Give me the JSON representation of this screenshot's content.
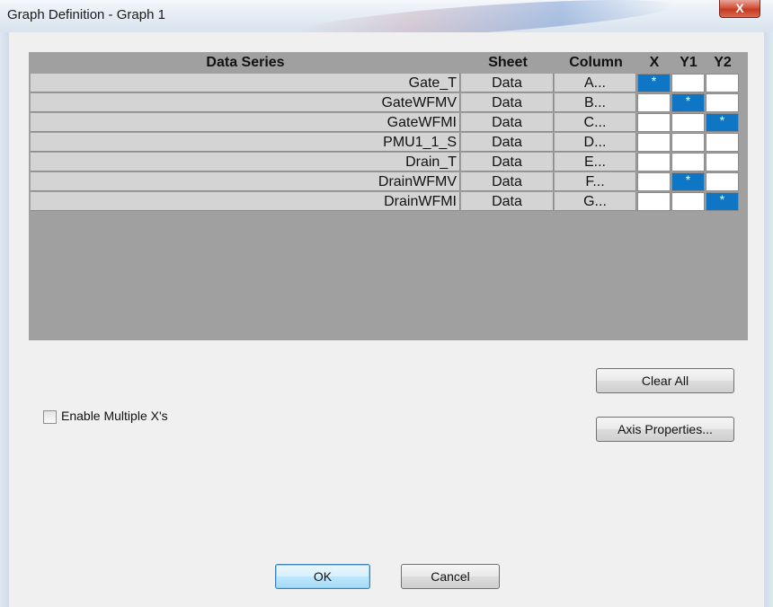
{
  "window": {
    "title": "Graph Definition - Graph 1",
    "close_label": "X"
  },
  "grid": {
    "headers": {
      "series": "Data Series",
      "sheet": "Sheet",
      "column": "Column",
      "x": "X",
      "y1": "Y1",
      "y2": "Y2"
    },
    "selected_marker": "*",
    "selected_color": "#0f76c6",
    "rows": [
      {
        "series": "Gate_T",
        "sheet": "Data",
        "column": "A...",
        "x": "*",
        "y1": "",
        "y2": ""
      },
      {
        "series": "GateWFMV",
        "sheet": "Data",
        "column": "B...",
        "x": "",
        "y1": "*",
        "y2": ""
      },
      {
        "series": "GateWFMI",
        "sheet": "Data",
        "column": "C...",
        "x": "",
        "y1": "",
        "y2": "*"
      },
      {
        "series": "PMU1_1_S",
        "sheet": "Data",
        "column": "D...",
        "x": "",
        "y1": "",
        "y2": ""
      },
      {
        "series": "Drain_T",
        "sheet": "Data",
        "column": "E...",
        "x": "",
        "y1": "",
        "y2": ""
      },
      {
        "series": "DrainWFMV",
        "sheet": "Data",
        "column": "F...",
        "x": "",
        "y1": "*",
        "y2": ""
      },
      {
        "series": "DrainWFMI",
        "sheet": "Data",
        "column": "G...",
        "x": "",
        "y1": "",
        "y2": "*"
      }
    ]
  },
  "buttons": {
    "clear_all": "Clear All",
    "axis_properties": "Axis Properties...",
    "ok": "OK",
    "cancel": "Cancel"
  },
  "options": {
    "enable_multiple_x_label": "Enable Multiple X's",
    "enable_multiple_x_checked": false
  }
}
